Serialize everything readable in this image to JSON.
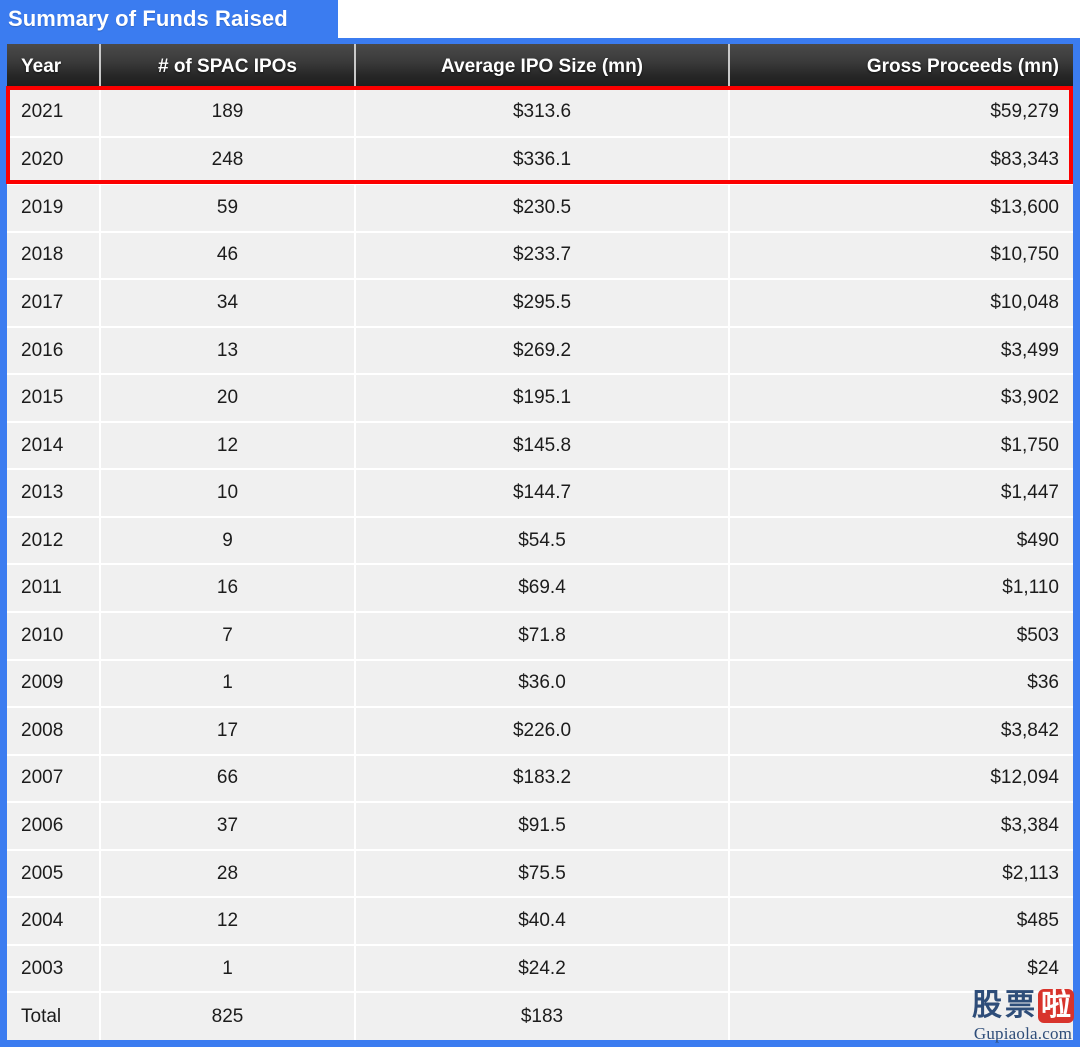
{
  "title": "Summary of Funds Raised",
  "theme": {
    "accent_blue": "#3b7cf0",
    "header_dark": "#262626",
    "highlight_red": "#fc0000",
    "row_bg": "#f0f0f0",
    "watermark_blue": "#2e4d79",
    "watermark_red": "#d8342c"
  },
  "table": {
    "columns": [
      {
        "key": "year",
        "label": "Year",
        "align": "left"
      },
      {
        "key": "count",
        "label": "# of SPAC IPOs",
        "align": "center"
      },
      {
        "key": "avg",
        "label": "Average IPO Size (mn)",
        "align": "center"
      },
      {
        "key": "gross",
        "label": "Gross Proceeds (mn)",
        "align": "right"
      }
    ],
    "rows": [
      {
        "year": "2021",
        "count": "189",
        "avg": "$313.6",
        "gross": "$59,279",
        "highlighted": true
      },
      {
        "year": "2020",
        "count": "248",
        "avg": "$336.1",
        "gross": "$83,343",
        "highlighted": true
      },
      {
        "year": "2019",
        "count": "59",
        "avg": "$230.5",
        "gross": "$13,600",
        "highlighted": false
      },
      {
        "year": "2018",
        "count": "46",
        "avg": "$233.7",
        "gross": "$10,750",
        "highlighted": false
      },
      {
        "year": "2017",
        "count": "34",
        "avg": "$295.5",
        "gross": "$10,048",
        "highlighted": false
      },
      {
        "year": "2016",
        "count": "13",
        "avg": "$269.2",
        "gross": "$3,499",
        "highlighted": false
      },
      {
        "year": "2015",
        "count": "20",
        "avg": "$195.1",
        "gross": "$3,902",
        "highlighted": false
      },
      {
        "year": "2014",
        "count": "12",
        "avg": "$145.8",
        "gross": "$1,750",
        "highlighted": false
      },
      {
        "year": "2013",
        "count": "10",
        "avg": "$144.7",
        "gross": "$1,447",
        "highlighted": false
      },
      {
        "year": "2012",
        "count": "9",
        "avg": "$54.5",
        "gross": "$490",
        "highlighted": false
      },
      {
        "year": "2011",
        "count": "16",
        "avg": "$69.4",
        "gross": "$1,110",
        "highlighted": false
      },
      {
        "year": "2010",
        "count": "7",
        "avg": "$71.8",
        "gross": "$503",
        "highlighted": false
      },
      {
        "year": "2009",
        "count": "1",
        "avg": "$36.0",
        "gross": "$36",
        "highlighted": false
      },
      {
        "year": "2008",
        "count": "17",
        "avg": "$226.0",
        "gross": "$3,842",
        "highlighted": false
      },
      {
        "year": "2007",
        "count": "66",
        "avg": "$183.2",
        "gross": "$12,094",
        "highlighted": false
      },
      {
        "year": "2006",
        "count": "37",
        "avg": "$91.5",
        "gross": "$3,384",
        "highlighted": false
      },
      {
        "year": "2005",
        "count": "28",
        "avg": "$75.5",
        "gross": "$2,113",
        "highlighted": false
      },
      {
        "year": "2004",
        "count": "12",
        "avg": "$40.4",
        "gross": "$485",
        "highlighted": false
      },
      {
        "year": "2003",
        "count": "1",
        "avg": "$24.2",
        "gross": "$24",
        "highlighted": false
      },
      {
        "year": "Total",
        "count": "825",
        "avg": "$183",
        "gross": "",
        "highlighted": false
      }
    ]
  },
  "watermark": {
    "characters": [
      "股",
      "票",
      "啦"
    ],
    "boxed_index": 2,
    "domain": "Gupiaola.com"
  },
  "chart_data": {
    "type": "table",
    "title": "Summary of Funds Raised",
    "columns": [
      "Year",
      "# of SPAC IPOs",
      "Average IPO Size (mn)",
      "Gross Proceeds (mn)"
    ],
    "categories": [
      "2021",
      "2020",
      "2019",
      "2018",
      "2017",
      "2016",
      "2015",
      "2014",
      "2013",
      "2012",
      "2011",
      "2010",
      "2009",
      "2008",
      "2007",
      "2006",
      "2005",
      "2004",
      "2003",
      "Total"
    ],
    "series": [
      {
        "name": "# of SPAC IPOs",
        "values": [
          189,
          248,
          59,
          46,
          34,
          13,
          20,
          12,
          10,
          9,
          16,
          7,
          1,
          17,
          66,
          37,
          28,
          12,
          1,
          825
        ]
      },
      {
        "name": "Average IPO Size (mn)",
        "values": [
          313.6,
          336.1,
          230.5,
          233.7,
          295.5,
          269.2,
          195.1,
          145.8,
          144.7,
          54.5,
          69.4,
          71.8,
          36.0,
          226.0,
          183.2,
          91.5,
          75.5,
          40.4,
          24.2,
          183
        ]
      },
      {
        "name": "Gross Proceeds (mn)",
        "values": [
          59279,
          83343,
          13600,
          10750,
          10048,
          3499,
          3902,
          1750,
          1447,
          490,
          1110,
          503,
          36,
          3842,
          12094,
          3384,
          2113,
          485,
          24,
          null
        ]
      }
    ],
    "highlighted_rows": [
      "2021",
      "2020"
    ],
    "grid": true,
    "legend": "none"
  }
}
